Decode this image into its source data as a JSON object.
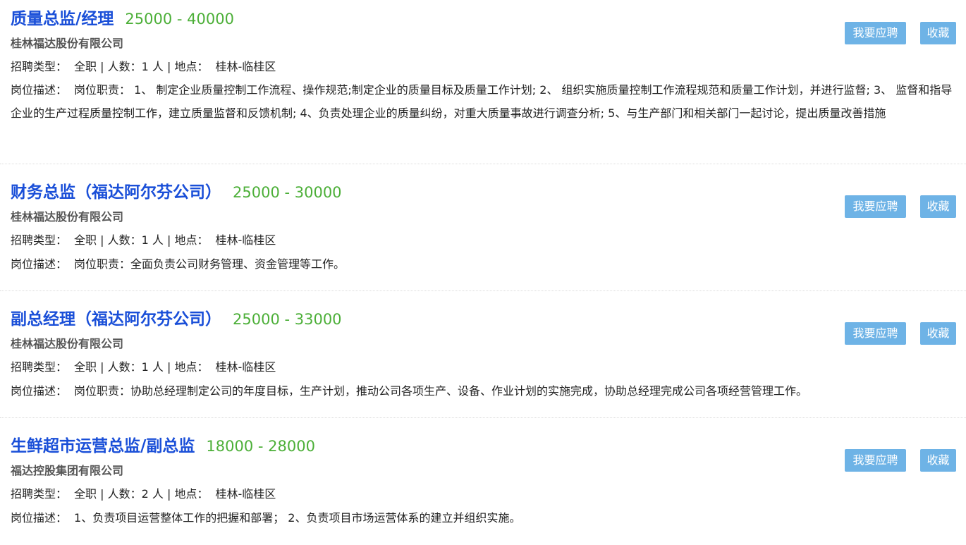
{
  "labels": {
    "type_label": "招聘类型：",
    "count_label": "人数：",
    "location_label": "地点：",
    "desc_label": "岗位描述：",
    "apply_button": "我要应聘",
    "favorite_button": "收藏"
  },
  "jobs": [
    {
      "title": "质量总监/经理",
      "salary": "25000 - 40000",
      "company": "桂林福达股份有限公司",
      "type": "全职",
      "count": "1 人",
      "location": "桂林-临桂区",
      "description": "岗位职责： 1、 制定企业质量控制工作流程、操作规范;制定企业的质量目标及质量工作计划; 2、 组织实施质量控制工作流程规范和质量工作计划，并进行监督; 3、 监督和指导企业的生产过程质量控制工作，建立质量监督和反馈机制; 4、负责处理企业的质量纠纷，对重大质量事故进行调查分析; 5、与生产部门和相关部门一起讨论，提出质量改善措施"
    },
    {
      "title": "财务总监（福达阿尔芬公司）",
      "salary": "25000 - 30000",
      "company": "桂林福达股份有限公司",
      "type": "全职",
      "count": "1 人",
      "location": "桂林-临桂区",
      "description": "岗位职责：全面负责公司财务管理、资金管理等工作。"
    },
    {
      "title": "副总经理（福达阿尔芬公司）",
      "salary": "25000 - 33000",
      "company": "桂林福达股份有限公司",
      "type": "全职",
      "count": "1 人",
      "location": "桂林-临桂区",
      "description": "岗位职责：协助总经理制定公司的年度目标，生产计划，推动公司各项生产、设备、作业计划的实施完成，协助总经理完成公司各项经营管理工作。"
    },
    {
      "title": "生鲜超市运营总监/副总监",
      "salary": "18000 - 28000",
      "company": "福达控股集团有限公司",
      "type": "全职",
      "count": "2 人",
      "location": "桂林-临桂区",
      "description": "1、负责项目运营整体工作的把握和部署； 2、负责项目市场运营体系的建立并组织实施。"
    }
  ]
}
